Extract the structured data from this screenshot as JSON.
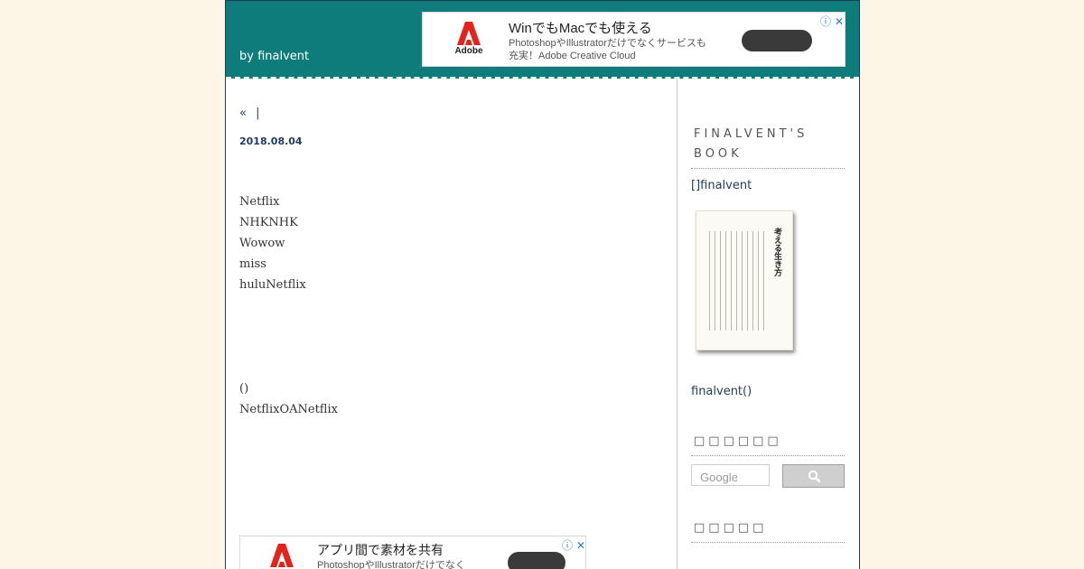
{
  "header": {
    "byline": "by finalvent",
    "background": "#0f7c7c"
  },
  "ad_top": {
    "brand": "Adobe",
    "title": "WinでもMacでも使える",
    "desc_line1": "PhotoshopやIllustratorだけでなくサービスも",
    "desc_line2": "充実！Adobe Creative Cloud",
    "choices_icons": [
      "info-icon",
      "close-icon"
    ]
  },
  "post": {
    "nav_prev": "«",
    "nav_sep": "|",
    "date": "2018.08.04",
    "lines_a": [
      "Netflix",
      "NHKNHK",
      "Wowow",
      "miss",
      "huluNetflix"
    ],
    "lines_b": [
      "()",
      "NetflixOANetflix"
    ]
  },
  "ad_bottom": {
    "title": "アプリ間で素材を共有",
    "desc_line1": "PhotoshopやIllustratorだけでなく"
  },
  "sidebar": {
    "book_heading": "FINALVENT'S BOOK",
    "book_link": "[]finalvent",
    "book_cover_title": "考える生き方",
    "book_caption": "finalvent()",
    "search_heading": "□□□□□□",
    "search_placeholder": "Google",
    "recent_heading": "□□□□□"
  }
}
